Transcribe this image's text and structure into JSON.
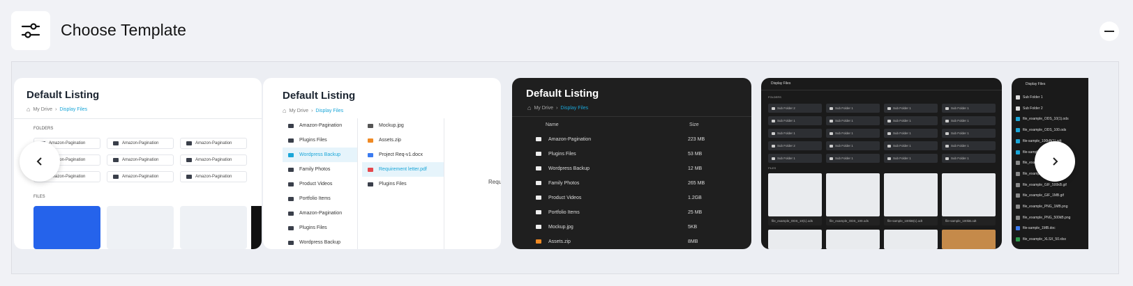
{
  "header": {
    "title": "Choose Template",
    "icon": "sliders-icon",
    "collapse_icon": "minus-icon"
  },
  "cards": [
    {
      "title": "Default Listing",
      "breadcrumb": {
        "root": "My Drive",
        "current": "Display Files"
      },
      "folders_label": "FOLDERS",
      "files_label": "FILES",
      "folder_name": "Amazon-Pagination"
    },
    {
      "title": "Default Listing",
      "breadcrumb": {
        "root": "My Drive",
        "current": "Display Files"
      },
      "col1": [
        "Amazon-Pagination",
        "Plugins Files",
        "Wordpress Backup",
        "Family Photos",
        "Product Videos",
        "Portfolio Items",
        "Amazon-Pagination",
        "Plugins Files",
        "Wordpress Backup"
      ],
      "col2": [
        "Mockup.jpg",
        "Assets.zip",
        "Project Req-v1.docx",
        "Requirement letter.pdf",
        "Plugins Files"
      ],
      "preview_text": "Requi"
    },
    {
      "title": "Default Listing",
      "breadcrumb": {
        "root": "My Drive",
        "current": "Display Files"
      },
      "col_name": "Name",
      "col_size": "Size",
      "rows": [
        {
          "name": "Amazon-Pagination",
          "size": "223 MB"
        },
        {
          "name": "Plugins Files",
          "size": "53 MB"
        },
        {
          "name": "Wordpress Backup",
          "size": "12 MB"
        },
        {
          "name": "Family Photos",
          "size": "265 MB"
        },
        {
          "name": "Product Videos",
          "size": "1.2GB"
        },
        {
          "name": "Portfolio Items",
          "size": "25 MB"
        },
        {
          "name": "Mockup.jpg",
          "size": "5KB"
        },
        {
          "name": "Assets.zip",
          "size": "8MB"
        }
      ]
    },
    {
      "title": "Display Files",
      "folders_label": "FOLDERS",
      "files_label": "FILES",
      "grid_folders": [
        "Sub Folder 2",
        "Sub Folder 1",
        "Sub Folder 1",
        "Sub Folder 1",
        "Sub Folder 1",
        "Sub Folder 1",
        "Sub Folder 1",
        "Sub Folder 1",
        "Sub Folder 1",
        "Sub Folder 1",
        "Sub Folder 1",
        "Sub Folder 1",
        "Sub Folder 2",
        "Sub Folder 1",
        "Sub Folder 1",
        "Sub Folder 1",
        "Sub Folder 1",
        "Sub Folder 1",
        "Sub Folder 1",
        "Sub Folder 1"
      ],
      "grid_files": [
        "file_example_ODS_10(1).ods",
        "file_example_ODS_100.ods",
        "file-sample_100kB(1).odt",
        "file-sample_100kB.odt"
      ]
    },
    {
      "title": "Display Files",
      "list": [
        "Sub Folder 1",
        "Sub Folder 2",
        "file_example_ODS_10(1).ods",
        "file_example_ODS_100.ods",
        "file-sample_100kB(1).odt",
        "file-sample_100kB.odt",
        "file_exa...",
        "file_example_...png",
        "file_example_GIF_500kB.gif",
        "file_example_GIF_1MB.gif",
        "file_example_PNG_1MB.png",
        "file_example_PNG_500kB.png",
        "file-sample_1MB.doc",
        "file_example_XLSX_50.xlsx"
      ]
    }
  ],
  "nav": {
    "prev_icon": "chevron-left-icon",
    "next_icon": "chevron-right-icon"
  }
}
